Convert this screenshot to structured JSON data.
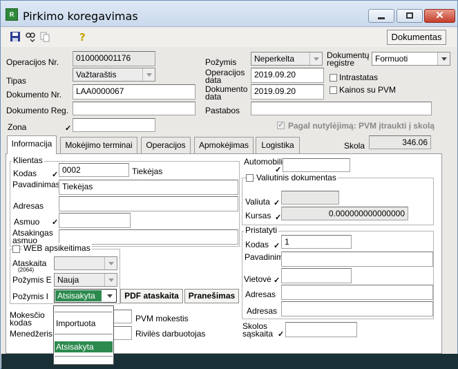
{
  "window": {
    "title": "Pirkimo koregavimas",
    "app_icon_text": "R"
  },
  "toolbar": {
    "documents_button": "Dokumentas"
  },
  "header": {
    "operation_no_label": "Operacijos Nr.",
    "operation_no": "010000001176",
    "type_label": "Tipas",
    "type_value": "Važtaraštis",
    "doc_no_label": "Dokumento Nr.",
    "doc_no": "LAA0000067",
    "doc_reg_label": "Dokumento Reg.",
    "doc_reg": "",
    "zone_label": "Zona",
    "zone": "",
    "feature_label": "Požymis",
    "feature_value": "Neperkelta",
    "op_date_label": "Operacijos data",
    "op_date": "2019.09.20",
    "doc_date_label": "Dokumento data",
    "doc_date": "2019.09.20",
    "notes_label": "Pastabos",
    "notes": "",
    "register_label": "Dokumentų registre",
    "register_value": "Formuoti",
    "intrastat_label": "Intrastatas",
    "prices_vat_label": "Kainos su PVM",
    "default_vat_label": "Pagal nutylėjimą: PVM įtraukti į skolą",
    "debt_label": "Skola",
    "debt_value": "346.06"
  },
  "tabs": [
    {
      "label": "Informacija"
    },
    {
      "label": "Mokėjimo terminai"
    },
    {
      "label": "Operacijos"
    },
    {
      "label": "Apmokėjimas"
    },
    {
      "label": "Logistika"
    }
  ],
  "info": {
    "clients_group": "Klientas",
    "code_label": "Kodas",
    "code": "0002",
    "client_type": "Tiekėjas",
    "name_label": "Pavadinimas",
    "name": "Tiekėjas",
    "address_label": "Adresas",
    "address": "",
    "person_label": "Asmuo",
    "person": "",
    "responsible_label": "Atsakingas asmuo",
    "responsible": "",
    "web_label": "WEB apsikeitimas",
    "report_label": "Ataskaita",
    "report_sub": "(2064)",
    "report_value": "",
    "feature_e_label": "Požymis E",
    "feature_e_value": "Nauja",
    "feature_i_label": "Požymis I",
    "feature_i_value": "Atsisakyta",
    "pdf_button": "PDF ataskaita",
    "notifications_button": "Pranešimas",
    "tax_code_label": "Mokesčio kodas",
    "tax_code_value": "PVM mokestis",
    "manager_label": "Menedžeris",
    "manager_value": "Rivilės darbuotojas",
    "vehicle_label": "Automobilis",
    "vehicle": "",
    "currency_doc_label": "Valiutinis dokumentas",
    "currency_label": "Valiuta",
    "currency": "",
    "rate_label": "Kursas",
    "rate": "0.000000000000000",
    "provider_group": "Pristatyti",
    "p_code_label": "Kodas",
    "p_code": "1",
    "p_name_label": "Pavadinimas",
    "p_name": "",
    "p_place_label": "Vietovė",
    "p_place": "",
    "p_address1_label": "Adresas",
    "p_address1": "",
    "p_address2_label": "Adresas",
    "p_address2": "",
    "debt_account_label": "Skolos sąskaita",
    "debt_account": ""
  },
  "dropdown": {
    "items": [
      "",
      "Importuota",
      "",
      "Atsisakyta",
      ""
    ]
  }
}
